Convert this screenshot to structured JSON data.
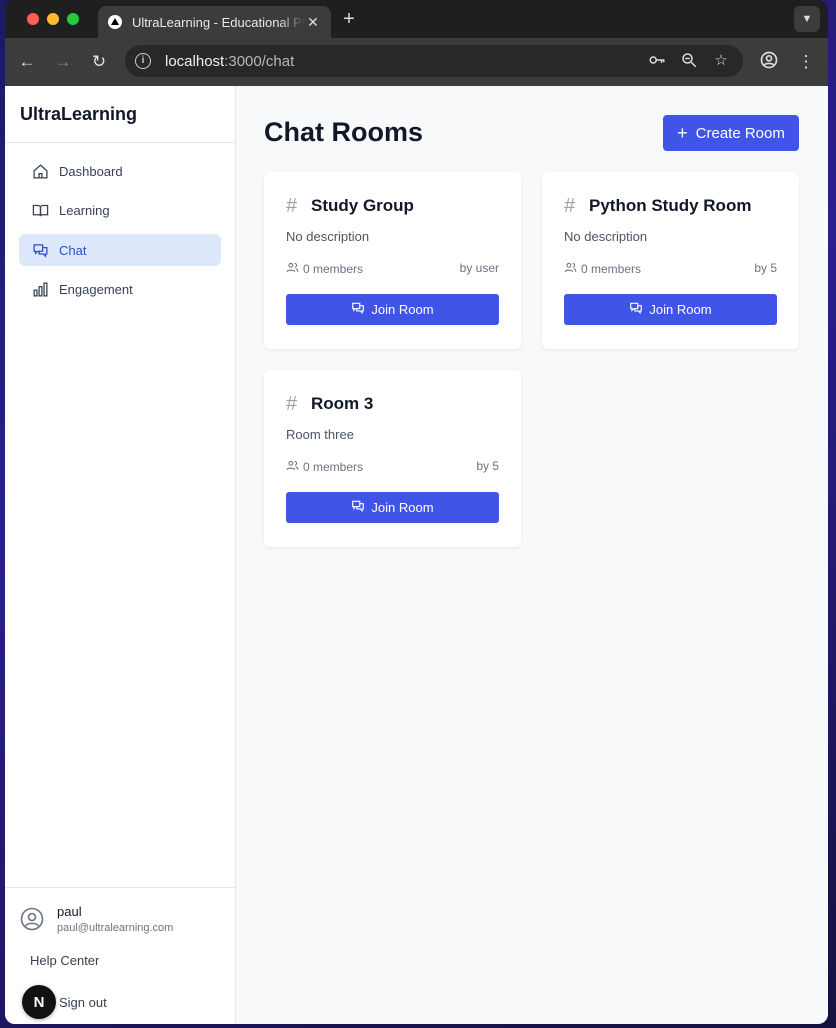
{
  "browser": {
    "tab_title": "UltraLearning - Educational Platform",
    "new_tab_icon": "plus-icon",
    "url_host": "localhost",
    "url_path": ":3000/chat"
  },
  "app": {
    "brand": "UltraLearning"
  },
  "sidebar": {
    "items": [
      {
        "label": "Dashboard",
        "icon": "home-icon"
      },
      {
        "label": "Learning",
        "icon": "book-icon"
      },
      {
        "label": "Chat",
        "icon": "chat-icon",
        "active": true
      },
      {
        "label": "Engagement",
        "icon": "bar-chart-icon"
      }
    ],
    "user": {
      "name": "paul",
      "email": "paul@ultralearning.com"
    },
    "help": "Help Center",
    "signout": "Sign out",
    "dev_badge": "N"
  },
  "main": {
    "title": "Chat Rooms",
    "create_label": "Create Room",
    "rooms": [
      {
        "name": "Study Group",
        "description": "No description",
        "members": "0 members",
        "creator": "by user",
        "join_label": "Join Room"
      },
      {
        "name": "Python Study Room",
        "description": "No description",
        "members": "0 members",
        "creator": "by 5",
        "join_label": "Join Room"
      },
      {
        "name": "Room 3",
        "description": "Room three",
        "members": "0 members",
        "creator": "by 5",
        "join_label": "Join Room"
      }
    ]
  },
  "colors": {
    "accent": "#4055e8",
    "active_nav_bg": "#dde8fa"
  }
}
